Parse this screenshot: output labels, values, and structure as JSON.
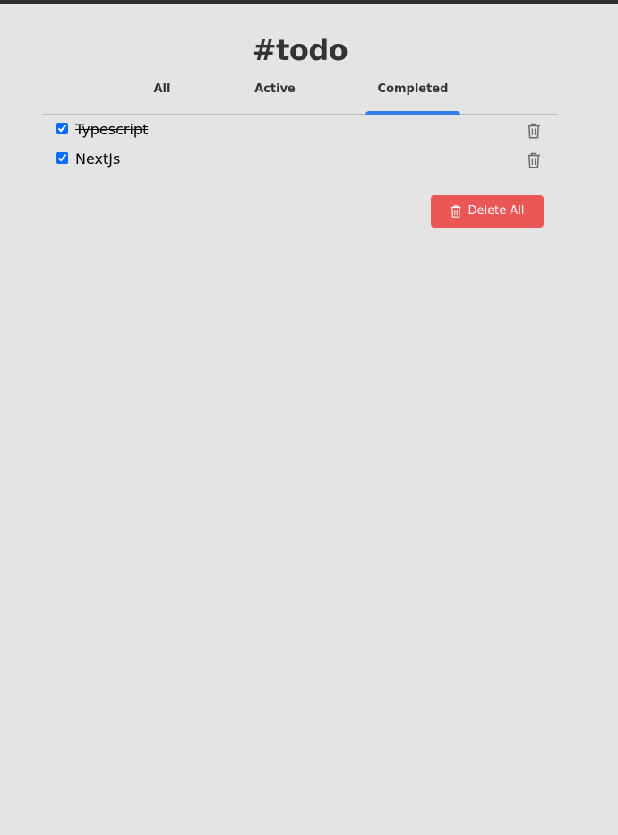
{
  "app": {
    "title": "#todo"
  },
  "tabs": [
    {
      "label": "All",
      "selected": false
    },
    {
      "label": "Active",
      "selected": false
    },
    {
      "label": "Completed",
      "selected": true
    }
  ],
  "todos": [
    {
      "text": "Typescript",
      "completed": true
    },
    {
      "text": "NextJs",
      "completed": true
    }
  ],
  "actions": {
    "delete_all_label": "Delete All",
    "delete_icon": "trash-icon"
  },
  "colors": {
    "background": "#e4e4e4",
    "accent": "#2f80ed",
    "danger": "#eb5757",
    "text": "#333333"
  }
}
